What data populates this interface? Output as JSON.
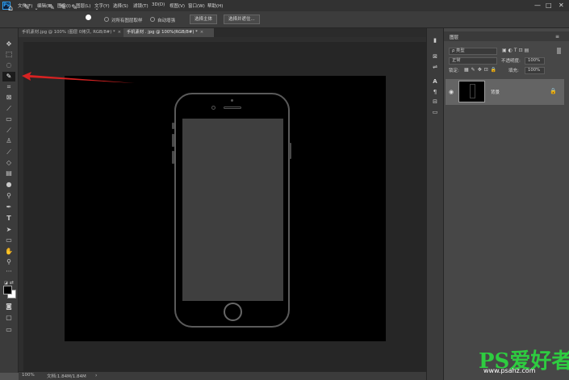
{
  "app": {
    "logo": "Ps"
  },
  "menu": {
    "items": [
      "文件(F)",
      "编辑(E)",
      "图像(I)",
      "图层(L)",
      "文字(Y)",
      "选择(S)",
      "滤镜(T)",
      "3D(D)",
      "视图(V)",
      "窗口(W)",
      "帮助(H)"
    ],
    "window_controls": {
      "minimize": "—",
      "maximize": "□",
      "close": "✕"
    }
  },
  "options_bar": {
    "sample_all_layers": "对所有图层取样",
    "auto_enhance": "自动增强",
    "select_subject": "选择主体",
    "select_and_mask": "选择并遮住..."
  },
  "tabs": [
    {
      "label": "手机素材.jpg @ 100% (图层 0拷贝, RGB/8#) *",
      "close": "×"
    },
    {
      "label": "手机素材 . jpg @ 100%(RGB/8#) *",
      "close": "×"
    }
  ],
  "status": {
    "zoom": "100%",
    "doc": "文档:1.84M/1.84M"
  },
  "layers_panel": {
    "title": "图层",
    "filter_kind": "ρ 类型",
    "blend_mode": "正常",
    "opacity_label": "不透明度:",
    "opacity_value": "100%",
    "lock_label": "锁定:",
    "fill_label": "填充:",
    "fill_value": "100%",
    "layer_name": "背景"
  },
  "watermark": {
    "main": "PS爱好者",
    "sub": "www.psahz.com"
  },
  "colors": {
    "arrow": "#d62222",
    "accent": "#2fa3f7",
    "watermark": "#2ecc40"
  }
}
